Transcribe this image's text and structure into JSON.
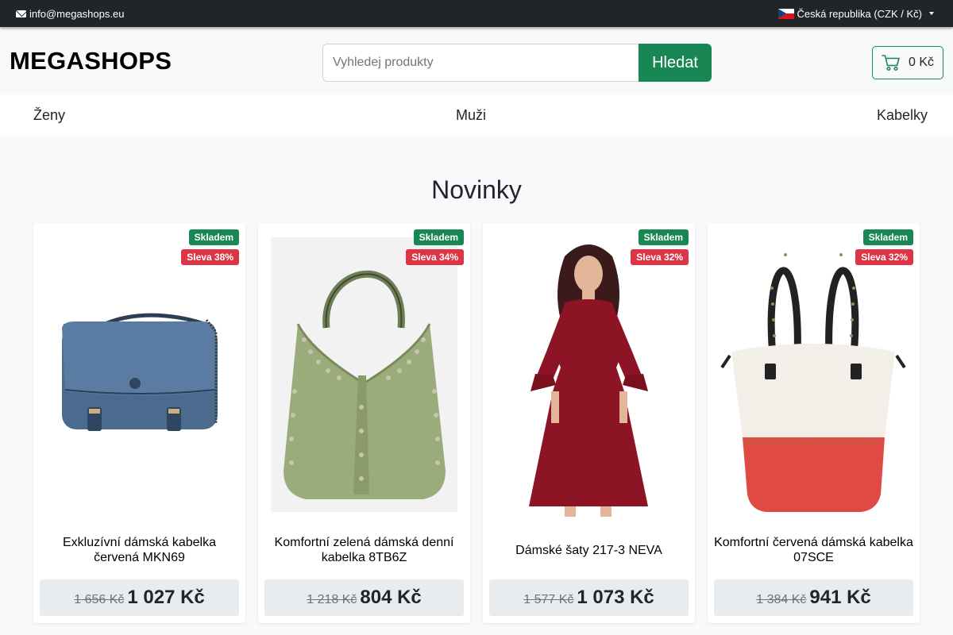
{
  "topbar": {
    "email": "info@megashops.eu",
    "country": "Česká republika (CZK / Kč)",
    "colors": {
      "background": "#212529",
      "text": "#ffffff"
    }
  },
  "header": {
    "logo": "MEGASHOPS",
    "search": {
      "placeholder": "Vyhledej produkty",
      "value": "",
      "button_label": "Hledat"
    },
    "cart": {
      "total": "0 Kč"
    },
    "colors": {
      "accent": "#198754"
    }
  },
  "nav": {
    "items": [
      {
        "label": "Ženy"
      },
      {
        "label": "Muži"
      },
      {
        "label": "Kabelky"
      }
    ]
  },
  "main": {
    "section_title": "Novinky",
    "products": [
      {
        "stock_badge": "Skladem",
        "discount_badge": "Sleva 38%",
        "title": "Exkluzívní dámská kabelka červená MKN69",
        "old_price": "1 656 Kč",
        "price": "1 027 Kč",
        "image": "blue-crossbody-bag-image"
      },
      {
        "stock_badge": "Skladem",
        "discount_badge": "Sleva 34%",
        "title": "Komfortní zelená dámská denní kabelka 8TB6Z",
        "old_price": "1 218 Kč",
        "price": "804 Kč",
        "image": "green-hobo-bag-image"
      },
      {
        "stock_badge": "Skladem",
        "discount_badge": "Sleva 32%",
        "title": "Dámské šaty 217-3 NEVA",
        "old_price": "1 577 Kč",
        "price": "1 073 Kč",
        "image": "burgundy-dress-model-image"
      },
      {
        "stock_badge": "Skladem",
        "discount_badge": "Sleva 32%",
        "title": "Komfortní červená dámská kabelka 07SCE",
        "old_price": "1 384 Kč",
        "price": "941 Kč",
        "image": "white-red-tote-bag-image"
      }
    ],
    "colors": {
      "stock_badge": "#198754",
      "discount_badge": "#dc3545"
    }
  }
}
